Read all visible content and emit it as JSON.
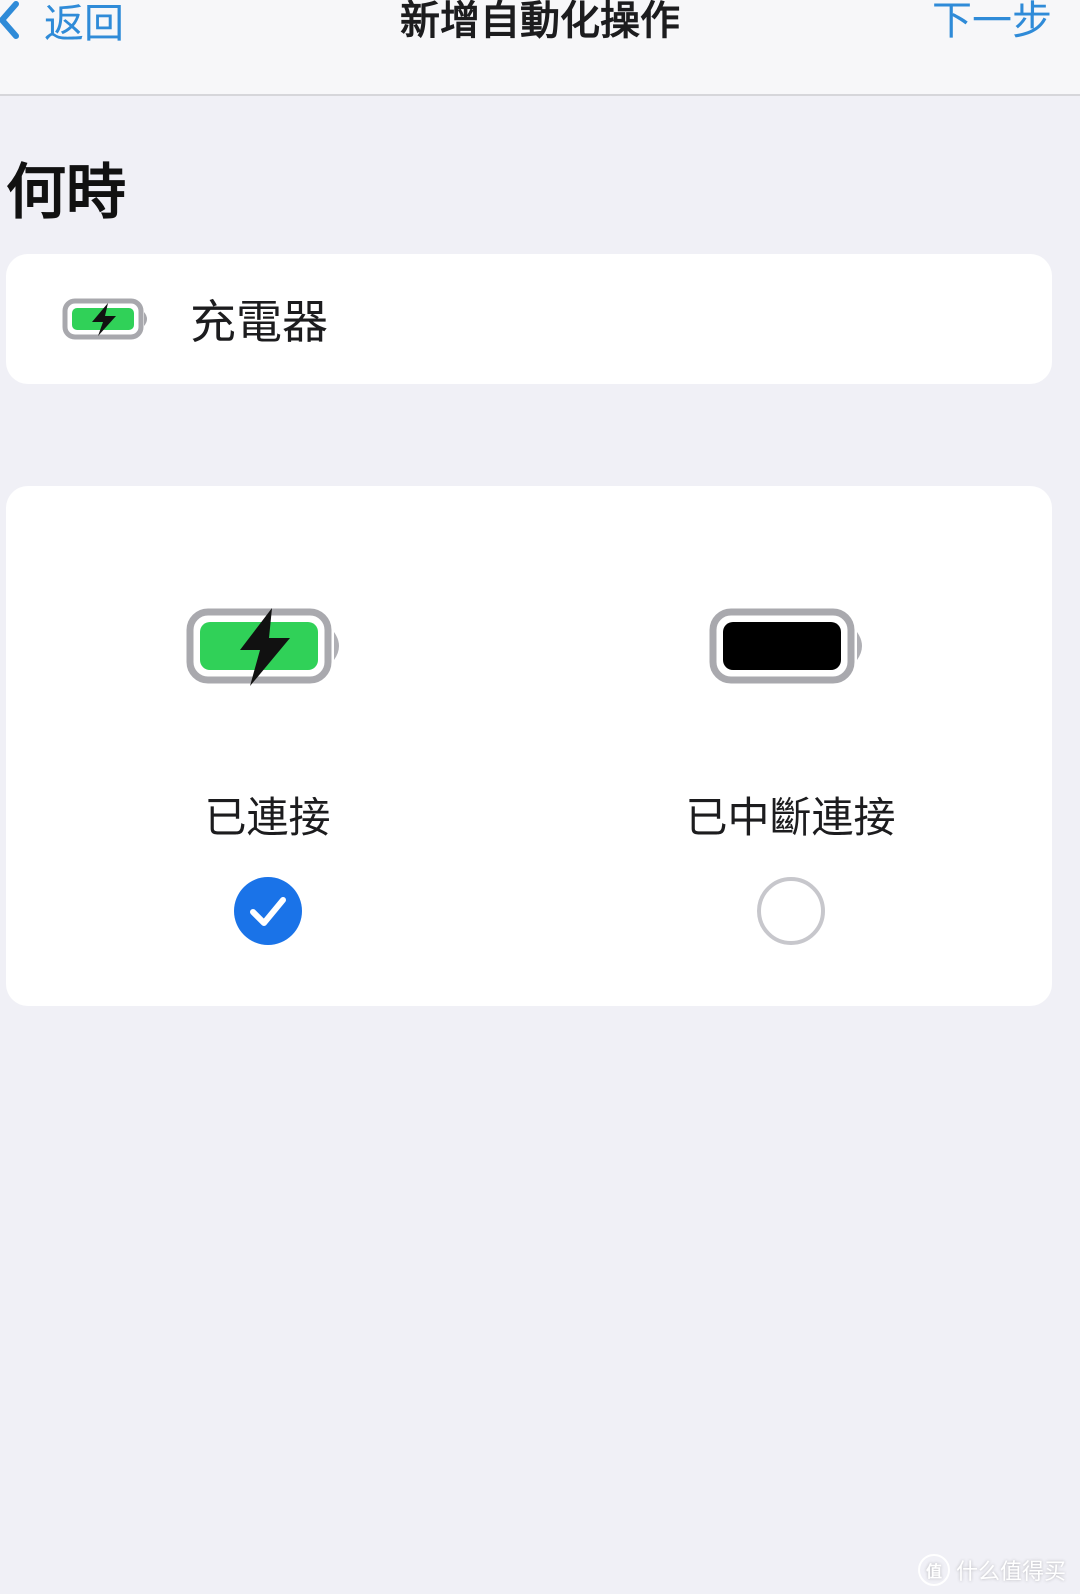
{
  "nav": {
    "back_label": "返回",
    "title": "新增自動化操作",
    "next_label": "下一步"
  },
  "section": {
    "title": "何時"
  },
  "trigger": {
    "label": "充電器",
    "icon": "battery-charging-icon"
  },
  "options": [
    {
      "label": "已連接",
      "icon": "battery-charging-icon",
      "selected": true
    },
    {
      "label": "已中斷連接",
      "icon": "battery-full-icon",
      "selected": false
    }
  ],
  "watermark": {
    "text": "什么值得买",
    "icon_text": "值"
  },
  "colors": {
    "accent": "#2f8bd8",
    "radio_selected": "#1a73e8",
    "battery_green": "#30d158",
    "background": "#f0f0f6",
    "card": "#ffffff"
  }
}
